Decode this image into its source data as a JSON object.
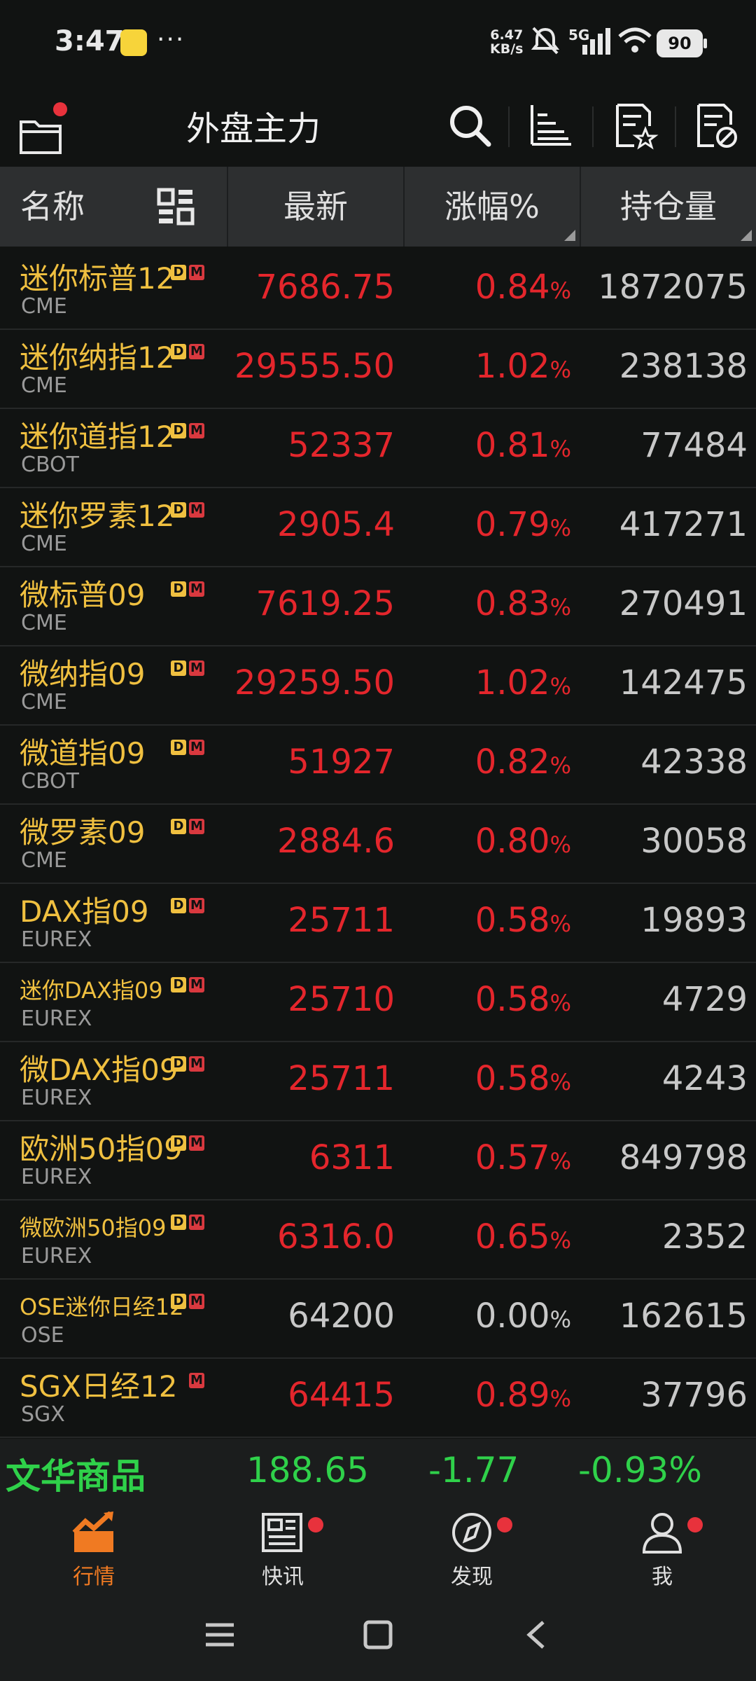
{
  "status": {
    "time": "3:47",
    "dots": "···",
    "speed_value": "6.47",
    "speed_unit": "KB/s",
    "network": "5G",
    "battery": "90"
  },
  "header": {
    "title": "外盘主力"
  },
  "columns": {
    "name": "名称",
    "latest": "最新",
    "change_pct": "涨幅%",
    "open_interest": "持仓量"
  },
  "rows": [
    {
      "name": "迷你标普12",
      "exchange": "CME",
      "d": true,
      "m": true,
      "price": "7686.75",
      "chg": "0.84",
      "oi": "1872075",
      "up": true
    },
    {
      "name": "迷你纳指12",
      "exchange": "CME",
      "d": true,
      "m": true,
      "price": "29555.50",
      "chg": "1.02",
      "oi": "238138",
      "up": true
    },
    {
      "name": "迷你道指12",
      "exchange": "CBOT",
      "d": true,
      "m": true,
      "price": "52337",
      "chg": "0.81",
      "oi": "77484",
      "up": true
    },
    {
      "name": "迷你罗素12",
      "exchange": "CME",
      "d": true,
      "m": true,
      "price": "2905.4",
      "chg": "0.79",
      "oi": "417271",
      "up": true
    },
    {
      "name": "微标普09",
      "exchange": "CME",
      "d": true,
      "m": true,
      "price": "7619.25",
      "chg": "0.83",
      "oi": "270491",
      "up": true
    },
    {
      "name": "微纳指09",
      "exchange": "CME",
      "d": true,
      "m": true,
      "price": "29259.50",
      "chg": "1.02",
      "oi": "142475",
      "up": true
    },
    {
      "name": "微道指09",
      "exchange": "CBOT",
      "d": true,
      "m": true,
      "price": "51927",
      "chg": "0.82",
      "oi": "42338",
      "up": true
    },
    {
      "name": "微罗素09",
      "exchange": "CME",
      "d": true,
      "m": true,
      "price": "2884.6",
      "chg": "0.80",
      "oi": "30058",
      "up": true
    },
    {
      "name": "DAX指09",
      "exchange": "EUREX",
      "d": true,
      "m": true,
      "price": "25711",
      "chg": "0.58",
      "oi": "19893",
      "up": true
    },
    {
      "name": "迷你DAX指09",
      "exchange": "EUREX",
      "d": true,
      "m": true,
      "price": "25710",
      "chg": "0.58",
      "oi": "4729",
      "up": true,
      "small": true
    },
    {
      "name": "微DAX指09",
      "exchange": "EUREX",
      "d": true,
      "m": true,
      "price": "25711",
      "chg": "0.58",
      "oi": "4243",
      "up": true
    },
    {
      "name": "欧洲50指09",
      "exchange": "EUREX",
      "d": true,
      "m": true,
      "price": "6311",
      "chg": "0.57",
      "oi": "849798",
      "up": true
    },
    {
      "name": "微欧洲50指09",
      "exchange": "EUREX",
      "d": true,
      "m": true,
      "price": "6316.0",
      "chg": "0.65",
      "oi": "2352",
      "up": true,
      "small": true
    },
    {
      "name": "OSE迷你日经12",
      "exchange": "OSE",
      "d": true,
      "m": true,
      "price": "64200",
      "chg": "0.00",
      "oi": "162615",
      "up": false,
      "small": true
    },
    {
      "name": "SGX日经12",
      "exchange": "SGX",
      "d": false,
      "m": true,
      "price": "64415",
      "chg": "0.89",
      "oi": "37796",
      "up": true
    }
  ],
  "pct_sign": "%",
  "tag_d": "D",
  "tag_m": "M",
  "index_bar": {
    "name": "文华商品",
    "value": "188.65",
    "change": "-1.77",
    "change_pct": "-0.93%"
  },
  "tabs": [
    {
      "label": "行情",
      "active": true,
      "dot": false
    },
    {
      "label": "快讯",
      "active": false,
      "dot": true
    },
    {
      "label": "发现",
      "active": false,
      "dot": true
    },
    {
      "label": "我",
      "active": false,
      "dot": true
    }
  ],
  "colors": {
    "up": "#e4262c",
    "flat": "#c8c8c8",
    "name": "#f0c040",
    "index_down": "#2fd14a",
    "active_tab": "#f07a22"
  }
}
